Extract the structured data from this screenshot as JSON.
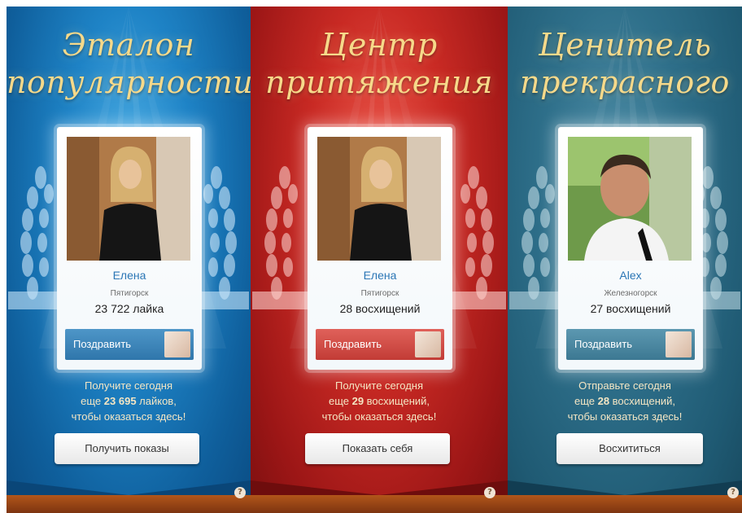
{
  "panels": [
    {
      "theme": "blue",
      "title_line1": "Эталон",
      "title_line2": "популярности",
      "name": "Елена",
      "city": "Пятигорск",
      "stat": "23 722 лайка",
      "congrats_label": "Поздравить",
      "promo_line1": "Получите сегодня",
      "promo_line2_prefix": "еще ",
      "promo_line2_number": "23 695",
      "promo_line2_suffix": " лайков,",
      "promo_line3": "чтобы оказаться здесь!",
      "action_label": "Получить показы",
      "help_label": "?"
    },
    {
      "theme": "red",
      "title_line1": "Центр",
      "title_line2": "притяжения",
      "name": "Елена",
      "city": "Пятигорск",
      "stat": "28 восхищений",
      "congrats_label": "Поздравить",
      "promo_line1": "Получите сегодня",
      "promo_line2_prefix": "еще ",
      "promo_line2_number": "29",
      "promo_line2_suffix": " восхищений,",
      "promo_line3": "чтобы оказаться здесь!",
      "action_label": "Показать себя",
      "help_label": "?"
    },
    {
      "theme": "teal",
      "title_line1": "Ценитель",
      "title_line2": "прекрасного",
      "name": "Alex",
      "city": "Железногорск",
      "stat": "27 восхищений",
      "congrats_label": "Поздравить",
      "promo_line1": "Отправьте сегодня",
      "promo_line2_prefix": "еще ",
      "promo_line2_number": "28",
      "promo_line2_suffix": " восхищений,",
      "promo_line3": "чтобы оказаться здесь!",
      "action_label": "Восхититься",
      "help_label": "?"
    }
  ],
  "colors": {
    "title_gold": "#f6d98a",
    "name_link": "#2b76b5",
    "promo_text": "#f4e6c4",
    "wood": "#9b4515"
  },
  "icons": {
    "help": "question-circle-icon",
    "gift": "gift-thumbnail-icon",
    "wreath": "laurel-wreath-icon"
  }
}
